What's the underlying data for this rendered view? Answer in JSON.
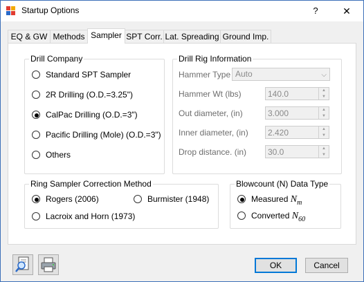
{
  "window": {
    "title": "Startup Options",
    "help_label": "?",
    "close_label": "✕"
  },
  "tabs": [
    {
      "label": "EQ & GW"
    },
    {
      "label": "Methods"
    },
    {
      "label": "Sampler"
    },
    {
      "label": "SPT Corr."
    },
    {
      "label": "Lat. Spreading"
    },
    {
      "label": "Ground Imp."
    }
  ],
  "drill_company": {
    "title": "Drill Company",
    "options": [
      {
        "label": "Standard SPT  Sampler",
        "selected": false
      },
      {
        "label": "2R Drilling (O.D.=3.25\")",
        "selected": false
      },
      {
        "label": "CalPac Drilling (O.D.=3\")",
        "selected": true
      },
      {
        "label": "Pacific Drilling (Mole)  (O.D.=3\")",
        "selected": false
      },
      {
        "label": "Others",
        "selected": false
      }
    ]
  },
  "drill_rig": {
    "title": "Drill Rig Information",
    "hammer_type_label": "Hammer Type",
    "hammer_type_value": "Auto",
    "fields": [
      {
        "label": "Hammer Wt (lbs)",
        "value": "140.0"
      },
      {
        "label": "Out diameter, (in)",
        "value": "3.000"
      },
      {
        "label": "Inner diameter, (in)",
        "value": "2.420"
      },
      {
        "label": "Drop distance. (in)",
        "value": "30.0"
      }
    ]
  },
  "ring_sampler": {
    "title": "Ring Sampler Correction Method",
    "options": [
      {
        "label": "Rogers (2006)",
        "selected": true
      },
      {
        "label": "Burmister (1948)",
        "selected": false
      },
      {
        "label": "Lacroix and Horn (1973)",
        "selected": false
      }
    ]
  },
  "blowcount": {
    "title": "Blowcount (N) Data Type",
    "measured_label": "Measured",
    "measured_symbol": "N",
    "measured_sub": "m",
    "measured_selected": true,
    "converted_label": "Converted",
    "converted_symbol": "N",
    "converted_sub": "60",
    "converted_selected": false
  },
  "footer": {
    "ok_label": "OK",
    "cancel_label": "Cancel"
  },
  "icons": {
    "preview": "magnifier-page-icon",
    "print": "printer-icon"
  },
  "colors": {
    "accent": "#0078d7",
    "window_border": "#3c6fb8",
    "disabled_text": "#6d6d6d"
  }
}
